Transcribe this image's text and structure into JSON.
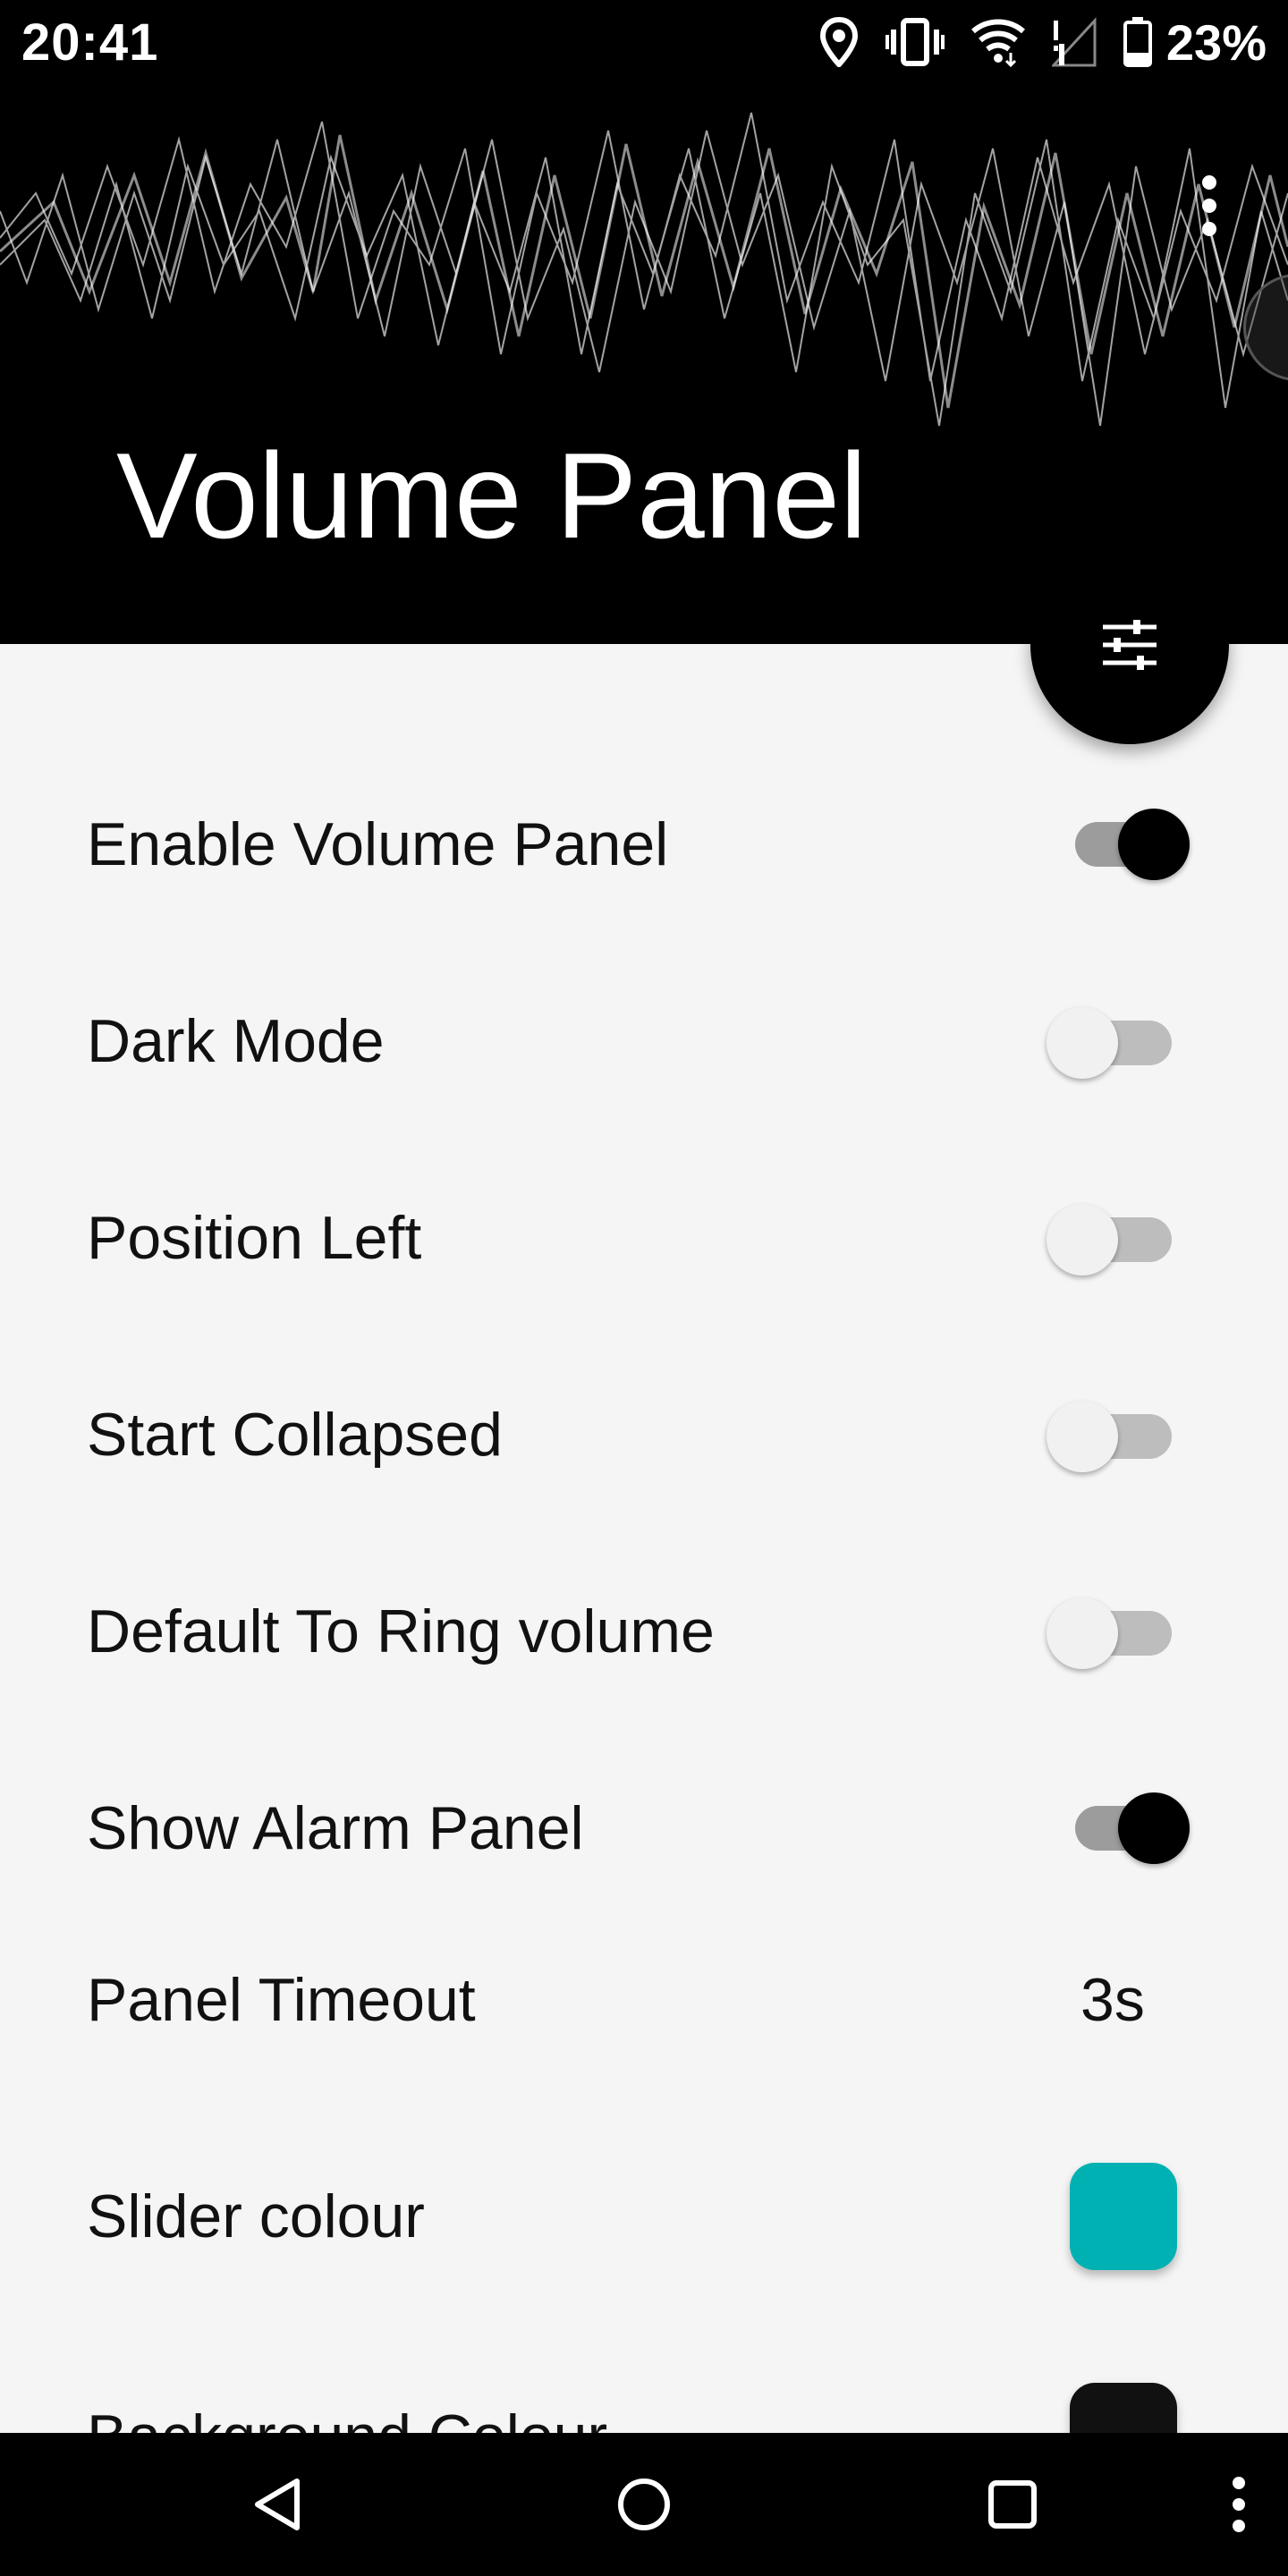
{
  "status_bar": {
    "time": "20:41",
    "battery": "23%",
    "icons": [
      "location-icon",
      "vibrate-icon",
      "wifi-icon",
      "signal-icon",
      "battery-icon"
    ]
  },
  "header": {
    "title": "Volume Panel",
    "menu_icon": "more-vert-icon",
    "fab_icon": "tune-sliders-icon"
  },
  "settings": {
    "enable": {
      "label": "Enable Volume Panel",
      "on": true
    },
    "dark_mode": {
      "label": "Dark Mode",
      "on": false
    },
    "position_left": {
      "label": "Position Left",
      "on": false
    },
    "start_collapsed": {
      "label": "Start Collapsed",
      "on": false
    },
    "default_ring": {
      "label": "Default To Ring volume",
      "on": false
    },
    "show_alarm": {
      "label": "Show Alarm Panel",
      "on": true
    },
    "timeout": {
      "label": "Panel Timeout",
      "value": "3s"
    },
    "slider_colour": {
      "label": "Slider colour",
      "color": "#00b1b3"
    },
    "background_colour": {
      "label": "Background Colour",
      "color": "#111111"
    }
  },
  "colors": {
    "header_bg": "#000000",
    "list_bg": "#f5f5f5",
    "switch_on_thumb": "#000000",
    "switch_off_thumb": "#f1f1f1"
  },
  "nav_bar": {
    "icons": [
      "back-icon",
      "home-icon",
      "recents-icon",
      "more-vert-icon"
    ]
  }
}
